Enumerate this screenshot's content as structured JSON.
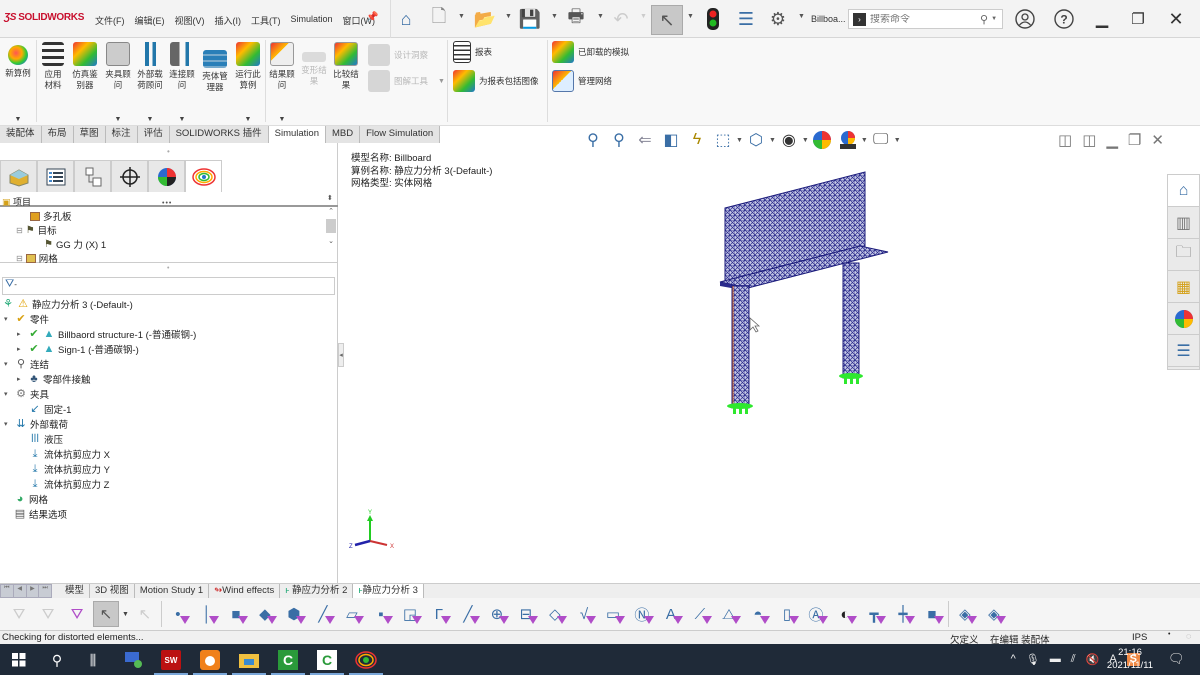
{
  "app": {
    "brand": "SOLIDWORKS",
    "document_name": "Billboa..."
  },
  "menu": [
    "文件(F)",
    "编辑(E)",
    "视图(V)",
    "插入(I)",
    "工具(T)",
    "Simulation",
    "窗口(W)"
  ],
  "search": {
    "placeholder": "搜索命令"
  },
  "quick_access_icons": [
    "home-icon",
    "new-document-icon",
    "open-icon",
    "save-icon",
    "print-icon",
    "undo-icon",
    "select-icon",
    "traffic-light-icon",
    "file-properties-icon",
    "options-gear-icon"
  ],
  "ribbon": {
    "buttons": [
      {
        "label": "新算例",
        "icon": "new-study-icon",
        "has_dropdown": true
      },
      {
        "label": "应用材料",
        "icon": "apply-material-icon",
        "has_dropdown": false
      },
      {
        "label": "仿真鉴别器",
        "icon": "simulation-evaluator-icon",
        "has_dropdown": false
      },
      {
        "label": "夹具顾问",
        "icon": "fixtures-advisor-icon",
        "has_dropdown": true
      },
      {
        "label": "外部载荷顾问",
        "icon": "external-loads-advisor-icon",
        "has_dropdown": true
      },
      {
        "label": "连接顾问",
        "icon": "connections-advisor-icon",
        "has_dropdown": true
      },
      {
        "label": "壳体管理器",
        "icon": "shell-manager-icon",
        "has_dropdown": false
      },
      {
        "label": "运行此算例",
        "icon": "run-study-icon",
        "has_dropdown": true
      },
      {
        "label": "结果顾问",
        "icon": "results-advisor-icon",
        "has_dropdown": true
      },
      {
        "label": "变形结果",
        "icon": "deformed-result-icon",
        "disabled": true
      },
      {
        "label": "比较结果",
        "icon": "compare-results-icon",
        "disabled": false
      }
    ],
    "small_buttons": [
      {
        "label": "设计洞察",
        "icon": "design-insight-icon",
        "disabled": true
      },
      {
        "label": "图解工具",
        "icon": "plot-tools-icon",
        "disabled": true,
        "has_dropdown": true
      },
      {
        "label": "报表",
        "icon": "report-icon"
      },
      {
        "label": "为报表包括图像",
        "icon": "include-image-icon"
      },
      {
        "label": "已卸载的模拟",
        "icon": "offloaded-simulation-icon"
      },
      {
        "label": "管理网络",
        "icon": "manage-network-icon"
      }
    ]
  },
  "command_tabs": [
    {
      "label": "装配体",
      "active": false
    },
    {
      "label": "布局",
      "active": false
    },
    {
      "label": "草图",
      "active": false
    },
    {
      "label": "标注",
      "active": false
    },
    {
      "label": "评估",
      "active": false
    },
    {
      "label": "SOLIDWORKS 插件",
      "active": false
    },
    {
      "label": "Simulation",
      "active": true
    },
    {
      "label": "MBD",
      "active": false
    },
    {
      "label": "Flow Simulation",
      "active": false
    }
  ],
  "panel_tabs": [
    "feature-manager-icon",
    "property-manager-icon",
    "configuration-manager-icon",
    "dimxpert-icon",
    "display-manager-icon",
    "simulation-study-icon"
  ],
  "project": {
    "header": "项目",
    "items": [
      {
        "label": "多孔板",
        "level": 2
      },
      {
        "label": "目标",
        "level": 1
      },
      {
        "label": "GG 力 (X) 1",
        "level": 2
      },
      {
        "label": "网格",
        "level": 1
      }
    ]
  },
  "filter": {
    "placeholder": ""
  },
  "study_tree": {
    "root": "静应力分析 3 (-Default-)",
    "items": [
      {
        "label": "零件",
        "level": 1,
        "expanded": true
      },
      {
        "label": "Billbaord structure-1 (-普通碳钢-)",
        "level": 2
      },
      {
        "label": "Sign-1 (-普通碳钢-)",
        "level": 2
      },
      {
        "label": "连结",
        "level": 1,
        "expanded": true
      },
      {
        "label": "零部件接触",
        "level": 2
      },
      {
        "label": "夹具",
        "level": 1,
        "expanded": true
      },
      {
        "label": "固定-1",
        "level": 2
      },
      {
        "label": "外部载荷",
        "level": 1,
        "expanded": true
      },
      {
        "label": "液压",
        "level": 2
      },
      {
        "label": "流体抗剪应力 X",
        "level": 2
      },
      {
        "label": "流体抗剪应力 Y",
        "level": 2
      },
      {
        "label": "流体抗剪应力 Z",
        "level": 2
      },
      {
        "label": "网格",
        "level": 1
      },
      {
        "label": "结果选项",
        "level": 1
      }
    ]
  },
  "viewport": {
    "info": {
      "model_name": "模型名称: Billboard",
      "study_name": "算例名称: 静应力分析 3(-Default-)",
      "mesh_type": "网格类型: 实体网格"
    },
    "triad": {
      "x": "X",
      "y": "Y",
      "z": "Z"
    },
    "mesh_color": "#2a2a8c"
  },
  "bottom_tabs": [
    {
      "label": "模型",
      "active": false
    },
    {
      "label": "3D 视图",
      "active": false
    },
    {
      "label": "Motion Study 1",
      "active": false
    },
    {
      "label": "Wind effects",
      "active": false
    },
    {
      "label": "静应力分析 2",
      "active": false
    },
    {
      "label": "静应力分析 3",
      "active": true
    }
  ],
  "status": {
    "message": "Checking for distorted elements...",
    "state": "欠定义",
    "editing": "在编辑 装配体",
    "units": "IPS"
  },
  "taskbar": {
    "time": "21:16",
    "date": "2021/11/11"
  },
  "colors": {
    "brand": "#c8102e",
    "accent": "#3a6ea5",
    "filter_purple": "#b04dc8",
    "taskbar": "#1f2a38"
  }
}
